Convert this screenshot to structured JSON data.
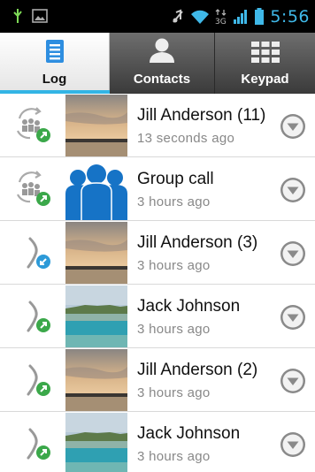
{
  "status_bar": {
    "time": "5:56",
    "icons": [
      "usb-icon",
      "image-icon",
      "mute-icon",
      "wifi-icon",
      "3g-icon",
      "signal-icon",
      "battery-icon"
    ],
    "network_label": "3G"
  },
  "tabs": [
    {
      "label": "Log",
      "icon": "log-icon",
      "selected": true
    },
    {
      "label": "Contacts",
      "icon": "contacts-icon",
      "selected": false
    },
    {
      "label": "Keypad",
      "icon": "keypad-icon",
      "selected": false
    }
  ],
  "colors": {
    "accent": "#33b5e5",
    "outgoing": "#3ba84a",
    "incoming": "#2d9ad8"
  },
  "calls": [
    {
      "name": "Jill Anderson (11)",
      "time": "13 seconds ago",
      "type": "conference-outgoing",
      "photo": "sunset"
    },
    {
      "name": "Group call",
      "time": "3 hours ago",
      "type": "conference-outgoing",
      "photo": "group"
    },
    {
      "name": "Jill Anderson (3)",
      "time": "3 hours ago",
      "type": "incoming",
      "photo": "sunset"
    },
    {
      "name": "Jack Johnson",
      "time": "3 hours ago",
      "type": "outgoing",
      "photo": "beach"
    },
    {
      "name": "Jill Anderson (2)",
      "time": "3 hours ago",
      "type": "outgoing",
      "photo": "sunset"
    },
    {
      "name": "Jack Johnson",
      "time": "3 hours ago",
      "type": "outgoing",
      "photo": "beach"
    }
  ]
}
